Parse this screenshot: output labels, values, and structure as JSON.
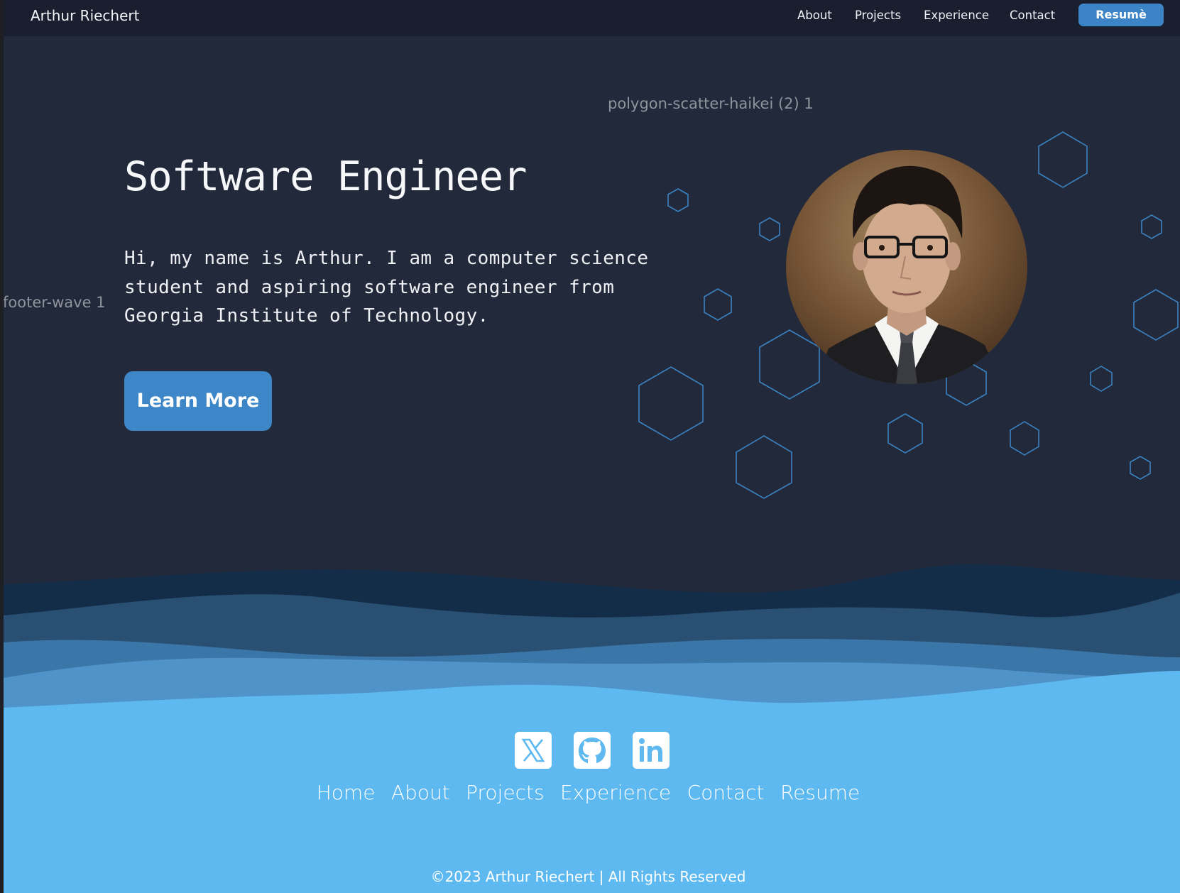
{
  "navbar": {
    "brand": "Arthur Riechert",
    "links": [
      "About",
      "Projects",
      "Experience",
      "Contact"
    ],
    "resume_label": "Resumè",
    "resume_color": "#3d84c6"
  },
  "figma_labels": {
    "polygon": "polygon-scatter-haikei (2) 1",
    "footer_wave": "footer-wave 1"
  },
  "hero": {
    "title": "Software Engineer",
    "intro_lines": [
      "Hi, my name is Arthur. I am a computer science",
      "student and aspiring software engineer from",
      "Georgia Institute of Technology."
    ],
    "cta_label": "Learn More",
    "cta_color": "#3d86c7"
  },
  "decor": {
    "hexagon_color": "#3b82c0",
    "wave_colors": [
      "#132c47",
      "#294f73",
      "#3b76a8",
      "#4f93c9",
      "#5db9f0"
    ]
  },
  "footer": {
    "social_icons": [
      "x-icon",
      "github-icon",
      "linkedin-icon"
    ],
    "links": [
      "Home",
      "About",
      "Projects",
      "Experience",
      "Contact",
      "Resume"
    ],
    "copyright": "©2023 Arthur Riechert | All Rights Reserved",
    "background": "#5db9f0"
  }
}
